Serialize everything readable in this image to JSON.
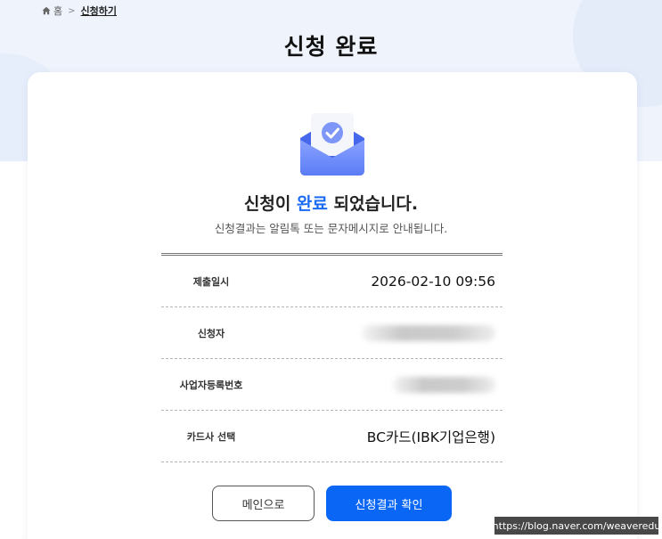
{
  "breadcrumb": {
    "home_label": "홈",
    "separator": ">",
    "current": "신청하기"
  },
  "page": {
    "title": "신청 완료"
  },
  "result": {
    "headline_prefix": "신청이 ",
    "headline_accent": "완료",
    "headline_suffix": " 되었습니다.",
    "subtext": "신청결과는 알림톡 또는 문자메시지로 안내됩니다."
  },
  "details": [
    {
      "label": "제출일시",
      "value": "2026-02-10 09:56"
    },
    {
      "label": "신청자",
      "value": ""
    },
    {
      "label": "사업자등록번호",
      "value": ""
    },
    {
      "label": "카드사 선택",
      "value": "BC카드(IBK기업은행)"
    }
  ],
  "buttons": {
    "main_label": "메인으로",
    "confirm_label": "신청결과 확인"
  },
  "watermark": "https://blog.naver.com/weaveredu",
  "colors": {
    "accent": "#1a6af2",
    "primary_button": "#0a67f5",
    "top_background": "#eef3fc",
    "envelope": "#5b7cf5"
  }
}
